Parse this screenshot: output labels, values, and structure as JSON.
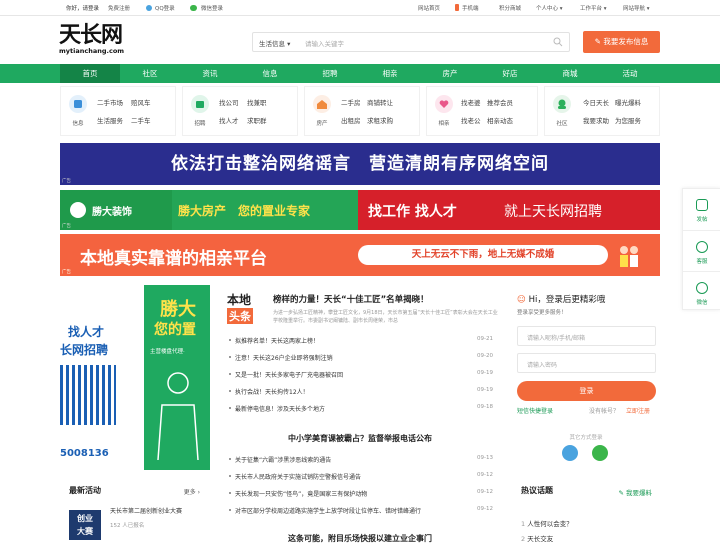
{
  "topbar": {
    "greeting": "你好，请登录",
    "register": "免费注册",
    "qq_login": "QQ登录",
    "wechat_login": "微信登录",
    "home": "网站首页",
    "mobile": "手机端",
    "points": "积分商城",
    "user_center": "个人中心 ▾",
    "workbench": "工作平台 ▾",
    "site_nav": "网站导航 ▾"
  },
  "logo": {
    "big": "天长网",
    "small": "mytianchang.com"
  },
  "search": {
    "category": "生活信息 ▾",
    "placeholder": "请输入关键字"
  },
  "post_button": "我要发布信息",
  "nav": [
    "首页",
    "社区",
    "资讯",
    "信息",
    "招聘",
    "相亲",
    "房产",
    "好店",
    "商城",
    "活动"
  ],
  "categories": [
    {
      "icon_label": "信息",
      "links": [
        "二手市场",
        "赔风车",
        "生活服务",
        "二手车"
      ]
    },
    {
      "icon_label": "招聘",
      "links": [
        "找公司",
        "找兼职",
        "找人才",
        "求职群"
      ]
    },
    {
      "icon_label": "房产",
      "links": [
        "二手房",
        "商铺转让",
        "出租房",
        "求租求购"
      ]
    },
    {
      "icon_label": "相亲",
      "links": [
        "找老婆",
        "推荐会员",
        "找老公",
        "相亲动态"
      ]
    },
    {
      "icon_label": "社区",
      "links": [
        "今日天长",
        "曝光爆料",
        "我要求助",
        "为您服务"
      ]
    }
  ],
  "banners": {
    "b1": "依法打击整治网络谣言　营造清朗有序网络空间",
    "b2_left": "勝大装饰",
    "b2_mid": "勝大房产　您的置业专家",
    "b2_right_a": "找工作 找人才",
    "b2_right_b": "就上天长网招聘",
    "b3_left": "本地真实靠谱的相亲平台",
    "b3_right": "天上无云不下雨，地上无媒不成婚",
    "ad_label": "广告"
  },
  "sidebar": [
    "发帖",
    "客服",
    "微信"
  ],
  "left_ad": {
    "line1": "找人才",
    "line2": "长网招聘",
    "phone": "5008136",
    "brand": "勝大",
    "brand2": "您的置",
    "sub": "主营楼盘代理·"
  },
  "headline": {
    "tag_a": "本地",
    "tag_b": "头条",
    "title": "榜样的力量！天长“十佳工匠”名单揭晓！",
    "summary": "为进一步弘扬工匠精神，攀登工匠文化，9月18日，天长市第五届“天长十佳工匠”表彰大会在天长工业学校隆重举行。市委副书记阚镛陆、副市长周继荣，市总"
  },
  "news1": [
    {
      "t": "拟推荐名单！天长这两家上榜！",
      "d": "09-21"
    },
    {
      "t": "注意！天长这26户企业即将强制注销",
      "d": "09-20"
    },
    {
      "t": "又是一批！天长多家电子厂充电器被召回",
      "d": "09-19"
    },
    {
      "t": "执行会战！天长拘传12人！",
      "d": "09-19"
    },
    {
      "t": "最新停电信息！涉及天长多个地方",
      "d": "09-18"
    }
  ],
  "news2_title": "中小学美育课被霸占？监督举报电话公布",
  "news2": [
    {
      "t": "关于征集“六霸”涉黑涉恶线索的通告",
      "d": "09-13"
    },
    {
      "t": "天长市人民政府关于实施试销防空警报信号通告",
      "d": "09-12"
    },
    {
      "t": "天长发现一只安伤“怪鸟”，竟是国家三有保护动物",
      "d": "09-12"
    },
    {
      "t": "对市区部分学校周边道路实施学生上放学时段让位停车、错时错峰通行",
      "d": "09-12"
    }
  ],
  "news_bottom": "这条可能，附目乐场快报以建立业企事门",
  "login": {
    "title": "Hi，登录后更精彩哦",
    "subtitle": "登录享受更多服务！",
    "user_ph": "请输入昵称/手机/邮箱",
    "pass_ph": "请输入密码",
    "button": "登录",
    "quick": "短信快捷登录",
    "no_account": "没有帐号？",
    "register": "立即注册",
    "third": "其它方式登录"
  },
  "activity": {
    "title": "最新活动",
    "more": "更多 ›",
    "item_title": "天长市第二届创新创业大赛",
    "item_sub": "152 人已报名",
    "img_a": "创业",
    "img_b": "大赛"
  },
  "hot": {
    "title": "热议话题",
    "action": "我要爆料",
    "items": [
      "人性何以会变？",
      "天长交友"
    ]
  },
  "colors": {
    "green": "#1fa960",
    "orange": "#f26a3b",
    "navy": "#2a2d8e"
  }
}
